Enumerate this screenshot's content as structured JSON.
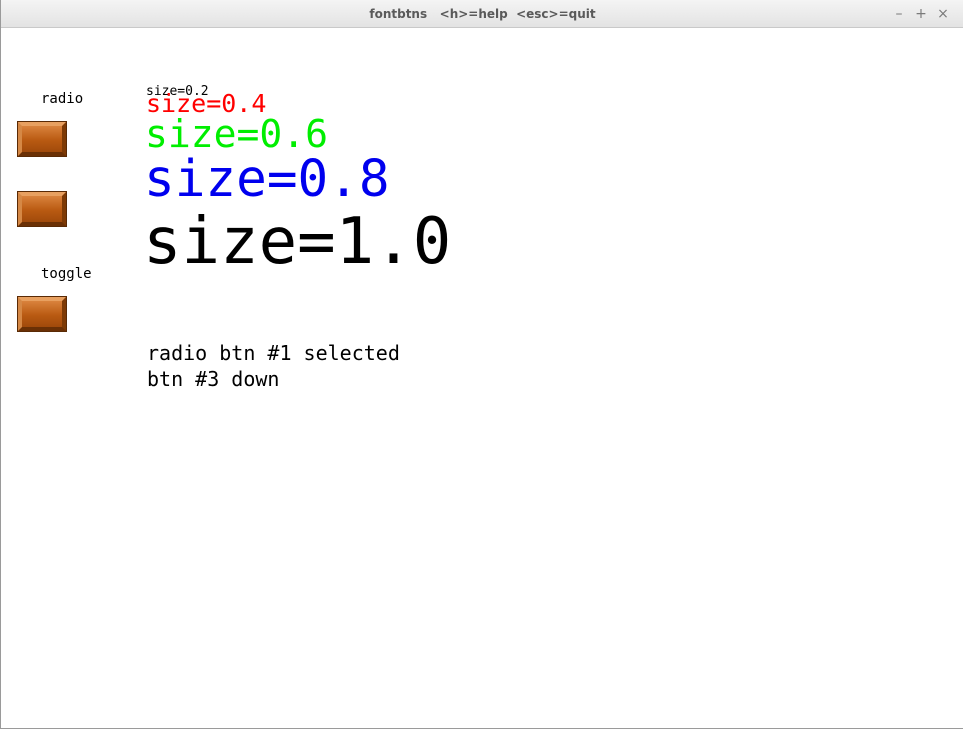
{
  "window": {
    "title": "fontbtns   <h>=help  <esc>=quit",
    "controls": {
      "minimize": "–",
      "maximize": "+",
      "close": "×"
    }
  },
  "sidebar": {
    "radio_label": "radio",
    "toggle_label": "toggle"
  },
  "samples": [
    {
      "text": "size=0.2",
      "color": "#000000"
    },
    {
      "text": "size=0.4",
      "color": "#ff0000"
    },
    {
      "text": "size=0.6",
      "color": "#00ee00"
    },
    {
      "text": "size=0.8",
      "color": "#0000ee"
    },
    {
      "text": "size=1.0",
      "color": "#000000"
    }
  ],
  "status": {
    "radio": "radio btn #1 selected",
    "button": "btn #3 down"
  }
}
